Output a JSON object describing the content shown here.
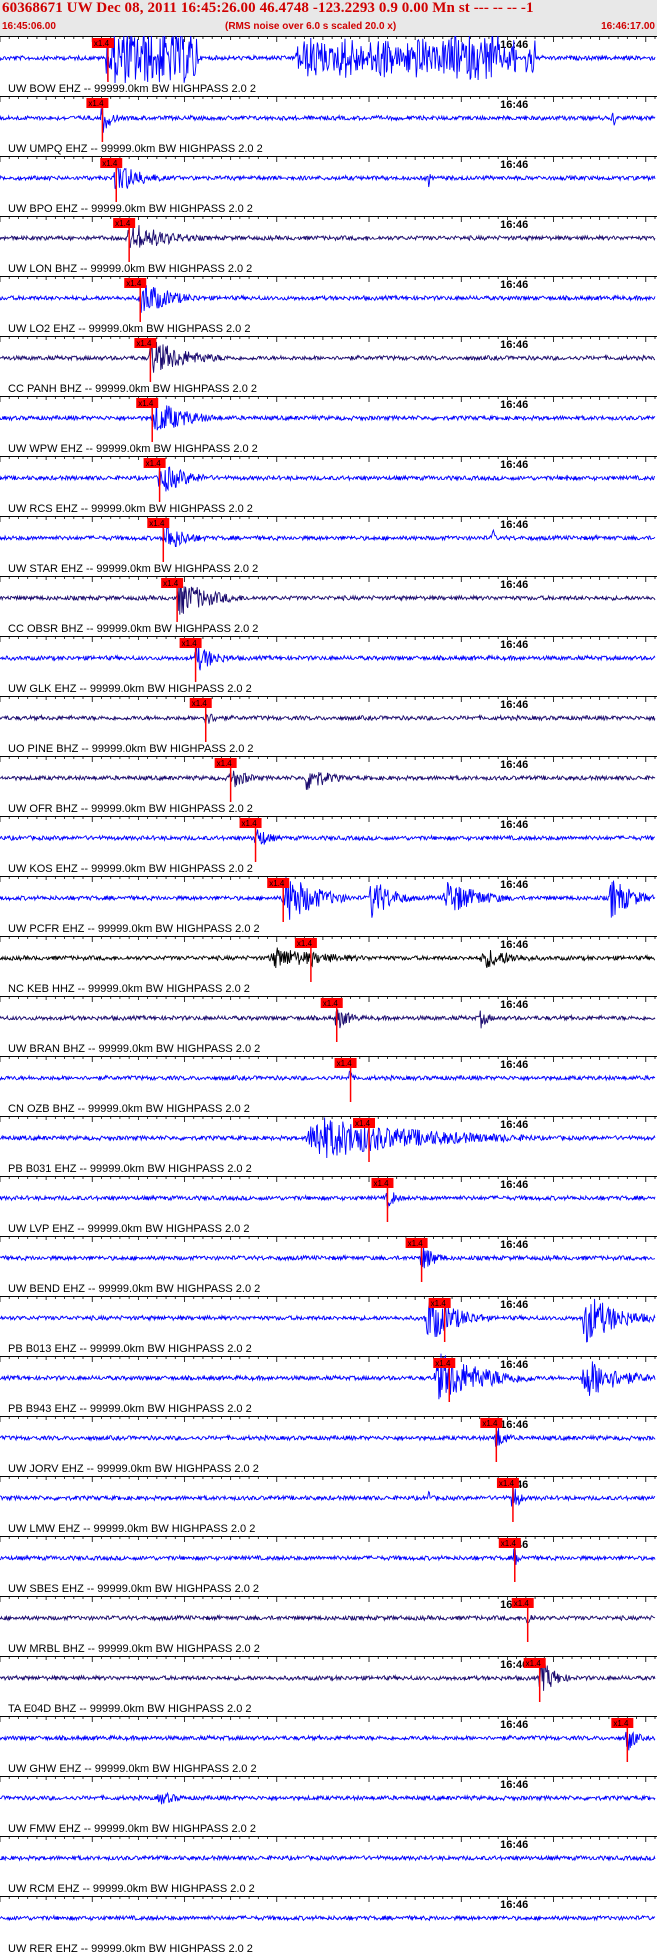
{
  "header": {
    "title": "60368671 UW Dec 08, 2011 16:45:26.00   46.4748 -123.2293  0.9 0.00 Mn st --- -- --   -1",
    "scale_note": "(RMS noise over 6.0 s scaled 20.0 x)",
    "start_time": "16:45:06.00",
    "end_time": "16:46:17.00"
  },
  "chart_data": {
    "type": "line",
    "title": "60368671 UW Dec 08, 2011 16:45:26.00   46.4748 -123.2293  0.9 0.00 Mn st --- -- --   -1",
    "x_range_seconds": [
      0,
      71
    ],
    "x_start": "16:45:06.00",
    "x_end": "16:46:17.00",
    "minute_label": "16:46",
    "minute_mark_seconds": 54,
    "pick_label": "x1.4",
    "colors": {
      "blue": "#0000ff",
      "navy": "#1a0a6e",
      "black": "#000000",
      "pick": "#ff0000"
    },
    "traces": [
      {
        "label": "UW BOW EHZ -- 99999.0km BW  HIGHPASS  2.0  2",
        "color": "blue",
        "pick": 11.7,
        "bursts": [
          [
            11.5,
            21.5,
            9,
            "box"
          ],
          [
            32,
            56,
            5,
            "spiky"
          ],
          [
            49,
            54,
            6,
            "spiky"
          ],
          [
            57,
            58,
            5,
            "spiky"
          ]
        ]
      },
      {
        "label": "UW UMPQ EHZ -- 99999.0km BW  HIGHPASS  2.0  2",
        "color": "blue",
        "pick": 11.1,
        "bursts": [
          [
            11,
            13,
            5,
            "burst"
          ],
          [
            66,
            67,
            4,
            "spike"
          ]
        ]
      },
      {
        "label": "UW BPO EHZ -- 99999.0km BW  HIGHPASS  2.0  2",
        "color": "blue",
        "pick": 12.6,
        "bursts": [
          [
            12.3,
            18,
            5,
            "burst"
          ],
          [
            46,
            47,
            3,
            "spike"
          ]
        ]
      },
      {
        "label": "UW LON BHZ -- 99999.0km BW  HIGHPASS  2.0  2",
        "color": "navy",
        "pick": 14,
        "bursts": [
          [
            14,
            23,
            4,
            "burst"
          ]
        ]
      },
      {
        "label": "UW LO2 EHZ -- 99999.0km BW  HIGHPASS  2.0  2",
        "color": "blue",
        "pick": 15.2,
        "bursts": [
          [
            15,
            22,
            5,
            "burst"
          ]
        ]
      },
      {
        "label": "CC PANH BHZ -- 99999.0km BW  HIGHPASS  2.0  2",
        "color": "navy",
        "pick": 16.3,
        "bursts": [
          [
            16,
            25,
            5,
            "burst"
          ]
        ]
      },
      {
        "label": "UW WPW EHZ -- 99999.0km BW  HIGHPASS  2.0  2",
        "color": "blue",
        "pick": 16.5,
        "bursts": [
          [
            16.5,
            24,
            5,
            "burst"
          ]
        ]
      },
      {
        "label": "UW RCS EHZ -- 99999.0km BW  HIGHPASS  2.0  2",
        "color": "blue",
        "pick": 17.3,
        "bursts": [
          [
            17.3,
            24,
            4,
            "burst"
          ],
          [
            61,
            62,
            2,
            "spike"
          ]
        ]
      },
      {
        "label": "UW STAR EHZ -- 99999.0km BW  HIGHPASS  2.0  2",
        "color": "blue",
        "pick": 17.7,
        "bursts": [
          [
            17.7,
            23,
            4,
            "burst"
          ],
          [
            53,
            54,
            4,
            "spike"
          ]
        ]
      },
      {
        "label": "CC OBSR BHZ -- 99999.0km BW  HIGHPASS  2.0  2",
        "color": "navy",
        "pick": 19.2,
        "bursts": [
          [
            19,
            27,
            5,
            "burst"
          ]
        ]
      },
      {
        "label": "UW GLK EHZ -- 99999.0km BW  HIGHPASS  2.0  2",
        "color": "blue",
        "pick": 21.2,
        "bursts": [
          [
            21,
            26,
            4,
            "burst"
          ]
        ]
      },
      {
        "label": "UO PINE BHZ -- 99999.0km BW  HIGHPASS  2.0  2",
        "color": "navy",
        "pick": 22.3,
        "bursts": [
          [
            22,
            26,
            2,
            "burst"
          ]
        ]
      },
      {
        "label": "UW OFR BHZ -- 99999.0km BW  HIGHPASS  2.0  2",
        "color": "navy",
        "pick": 25,
        "bursts": [
          [
            25,
            29,
            3,
            "burst"
          ],
          [
            33,
            38,
            4,
            "burst"
          ]
        ]
      },
      {
        "label": "UW KOS EHZ -- 99999.0km BW  HIGHPASS  2.0  2",
        "color": "blue",
        "pick": 27.7,
        "bursts": [
          [
            27.7,
            31,
            3,
            "burst"
          ]
        ]
      },
      {
        "label": "UW PCFR EHZ -- 99999.0km BW  HIGHPASS  2.0  2",
        "color": "blue",
        "pick": 30.7,
        "bursts": [
          [
            30.7,
            38,
            7,
            "burst"
          ],
          [
            40,
            45,
            6,
            "burst"
          ],
          [
            48,
            56,
            5,
            "burst"
          ],
          [
            66,
            71,
            6,
            "burst"
          ]
        ]
      },
      {
        "label": "NC KEB HHZ -- 99999.0km BW  HIGHPASS  2.0  2",
        "color": "black",
        "pick": 33.7,
        "bursts": [
          [
            29,
            43,
            3,
            "burst"
          ],
          [
            52,
            60,
            3,
            "burst"
          ]
        ]
      },
      {
        "label": "UW BRAN BHZ -- 99999.0km BW  HIGHPASS  2.0  2",
        "color": "navy",
        "pick": 36.5,
        "bursts": [
          [
            36.5,
            40,
            3,
            "burst"
          ],
          [
            52,
            54,
            3,
            "burst"
          ]
        ]
      },
      {
        "label": "CN OZB BHZ -- 99999.0km BW  HIGHPASS  2.0  2",
        "color": "blue",
        "pick": 38,
        "bursts": []
      },
      {
        "label": "PB B031 EHZ -- 99999.0km BW  HIGHPASS  2.0  2",
        "color": "blue",
        "pick": 40,
        "bursts": [
          [
            33,
            58,
            6,
            "burst"
          ]
        ]
      },
      {
        "label": "UW LVP EHZ -- 99999.0km BW  HIGHPASS  2.0  2",
        "color": "blue",
        "pick": 42,
        "bursts": [
          [
            42,
            44,
            3,
            "burst"
          ]
        ]
      },
      {
        "label": "UW BEND EHZ -- 99999.0km BW  HIGHPASS  2.0  2",
        "color": "blue",
        "pick": 45.7,
        "bursts": [
          [
            45.5,
            49,
            4,
            "burst"
          ]
        ]
      },
      {
        "label": "PB B013 EHZ -- 99999.0km BW  HIGHPASS  2.0  2",
        "color": "blue",
        "pick": 48.2,
        "bursts": [
          [
            46,
            53,
            7,
            "burst"
          ],
          [
            63,
            71,
            7,
            "burst"
          ]
        ]
      },
      {
        "label": "PB B943 EHZ -- 99999.0km BW  HIGHPASS  2.0  2",
        "color": "blue",
        "pick": 48.7,
        "bursts": [
          [
            47,
            58,
            7,
            "burst"
          ],
          [
            63,
            71,
            6,
            "burst"
          ]
        ]
      },
      {
        "label": "UW JORV EHZ -- 99999.0km BW  HIGHPASS  2.0  2",
        "color": "blue",
        "pick": 53.8,
        "bursts": [
          [
            53.5,
            56,
            4,
            "burst"
          ]
        ]
      },
      {
        "label": "UW LMW EHZ -- 99999.0km BW  HIGHPASS  2.0  2",
        "color": "blue",
        "pick": 55.6,
        "bursts": [
          [
            46,
            47,
            3,
            "spike"
          ],
          [
            55.5,
            57,
            5,
            "burst"
          ]
        ]
      },
      {
        "label": "UW SBES EHZ -- 99999.0km BW  HIGHPASS  2.0  2",
        "color": "blue",
        "pick": 55.8,
        "bursts": [
          [
            55.8,
            61,
            1,
            "burst"
          ]
        ]
      },
      {
        "label": "UW MRBL BHZ -- 99999.0km BW  HIGHPASS  2.0  2",
        "color": "navy",
        "pick": 57.2,
        "bursts": [
          [
            57,
            59,
            2,
            "burst"
          ]
        ]
      },
      {
        "label": "TA E04D BHZ -- 99999.0km BW  HIGHPASS  2.0  2",
        "color": "navy",
        "pick": 58.5,
        "bursts": [
          [
            58.5,
            62,
            5,
            "burst"
          ]
        ]
      },
      {
        "label": "UW GHW EHZ -- 99999.0km BW  HIGHPASS  2.0  2",
        "color": "blue",
        "pick": 68,
        "bursts": [
          [
            68,
            70,
            4,
            "burst"
          ]
        ]
      },
      {
        "label": "UW FMW EHZ -- 99999.0km BW  HIGHPASS  2.0  2",
        "color": "blue",
        "pick": null,
        "bursts": [
          [
            17,
            22,
            2,
            "burst"
          ]
        ]
      },
      {
        "label": "UW RCM EHZ -- 99999.0km BW  HIGHPASS  2.0  2",
        "color": "blue",
        "pick": null,
        "bursts": []
      },
      {
        "label": "UW RER EHZ -- 99999.0km BW  HIGHPASS  2.0  2",
        "color": "blue",
        "pick": null,
        "bursts": []
      }
    ]
  }
}
